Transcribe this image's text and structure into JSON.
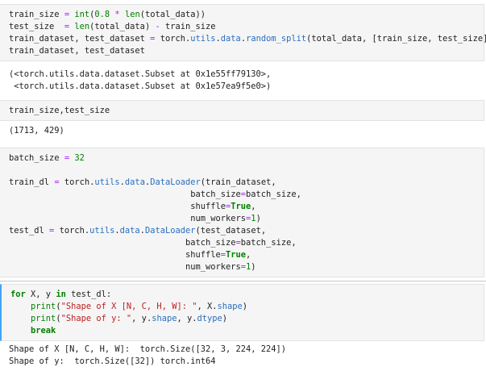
{
  "cells": [
    {
      "id": "split",
      "lines": [
        [
          [
            "train_size",
            ""
          ],
          [
            " = ",
            "op"
          ],
          [
            "int",
            "bi"
          ],
          [
            "(",
            ""
          ],
          [
            "0.8",
            "num"
          ],
          [
            " * ",
            "op"
          ],
          [
            "len",
            "bi"
          ],
          [
            "(total_data))",
            ""
          ]
        ],
        [
          [
            "test_size ",
            ""
          ],
          [
            " = ",
            "op"
          ],
          [
            "len",
            "bi"
          ],
          [
            "(total_data) ",
            ""
          ],
          [
            "-",
            "op"
          ],
          [
            " train_size",
            ""
          ]
        ],
        [
          [
            "train_dataset, test_dataset ",
            ""
          ],
          [
            "=",
            "op"
          ],
          [
            " torch.",
            ""
          ],
          [
            "utils",
            "attr"
          ],
          [
            ".",
            ""
          ],
          [
            "data",
            "attr"
          ],
          [
            ".",
            ""
          ],
          [
            "random_split",
            "attr"
          ],
          [
            "(total_data, [train_size, test_size])",
            ""
          ]
        ],
        [
          [
            "train_dataset, test_dataset",
            ""
          ]
        ]
      ],
      "output": [
        "(<torch.utils.data.dataset.Subset at 0x1e55ff79130>,",
        " <torch.utils.data.dataset.Subset at 0x1e57ea9f5e0>)"
      ]
    },
    {
      "id": "sizes",
      "lines": [
        [
          [
            "train_size,test_size",
            ""
          ]
        ]
      ],
      "output": [
        "(1713, 429)"
      ]
    },
    {
      "id": "loaders",
      "lines": [
        [
          [
            "batch_size ",
            ""
          ],
          [
            "=",
            "op"
          ],
          [
            " ",
            ""
          ],
          [
            "32",
            "num"
          ]
        ],
        [
          [
            "",
            ""
          ]
        ],
        [
          [
            "train_dl ",
            ""
          ],
          [
            "=",
            "op"
          ],
          [
            " torch.",
            ""
          ],
          [
            "utils",
            "attr"
          ],
          [
            ".",
            ""
          ],
          [
            "data",
            "attr"
          ],
          [
            ".",
            ""
          ],
          [
            "DataLoader",
            "attr"
          ],
          [
            "(train_dataset,",
            ""
          ]
        ],
        [
          [
            "                                    batch_size",
            ""
          ],
          [
            "=",
            "op"
          ],
          [
            "batch_size,",
            ""
          ]
        ],
        [
          [
            "                                    shuffle",
            ""
          ],
          [
            "=",
            "op"
          ],
          [
            "True",
            "kw"
          ],
          [
            ",",
            ""
          ]
        ],
        [
          [
            "                                    num_workers",
            ""
          ],
          [
            "=",
            "op"
          ],
          [
            "1",
            "num"
          ],
          [
            ")",
            ""
          ]
        ],
        [
          [
            "test_dl ",
            ""
          ],
          [
            "=",
            "op"
          ],
          [
            " torch.",
            ""
          ],
          [
            "utils",
            "attr"
          ],
          [
            ".",
            ""
          ],
          [
            "data",
            "attr"
          ],
          [
            ".",
            ""
          ],
          [
            "DataLoader",
            "attr"
          ],
          [
            "(test_dataset,",
            ""
          ]
        ],
        [
          [
            "                                   batch_size",
            ""
          ],
          [
            "=",
            "op"
          ],
          [
            "batch_size,",
            ""
          ]
        ],
        [
          [
            "                                   shuffle",
            ""
          ],
          [
            "=",
            "op"
          ],
          [
            "True",
            "kw"
          ],
          [
            ",",
            ""
          ]
        ],
        [
          [
            "                                   num_workers",
            ""
          ],
          [
            "=",
            "op"
          ],
          [
            "1",
            "num"
          ],
          [
            ")",
            ""
          ]
        ]
      ],
      "output": []
    },
    {
      "id": "shapes",
      "lines": [
        [
          [
            "for",
            "kw"
          ],
          [
            " X, y ",
            ""
          ],
          [
            "in",
            "kw"
          ],
          [
            " test_dl:",
            ""
          ]
        ],
        [
          [
            "    ",
            ""
          ],
          [
            "print",
            "bi"
          ],
          [
            "(",
            ""
          ],
          [
            "\"Shape of X [N, C, H, W]: \"",
            "str"
          ],
          [
            ", X.",
            ""
          ],
          [
            "shape",
            "attr"
          ],
          [
            ")",
            ""
          ]
        ],
        [
          [
            "    ",
            ""
          ],
          [
            "print",
            "bi"
          ],
          [
            "(",
            ""
          ],
          [
            "\"Shape of y: \"",
            "str"
          ],
          [
            ", y.",
            ""
          ],
          [
            "shape",
            "attr"
          ],
          [
            ", y.",
            ""
          ],
          [
            "dtype",
            "attr"
          ],
          [
            ")",
            ""
          ]
        ],
        [
          [
            "    ",
            ""
          ],
          [
            "break",
            "kw"
          ]
        ]
      ],
      "output": [
        "Shape of X [N, C, H, W]:  torch.Size([32, 3, 224, 224])",
        "Shape of y:  torch.Size([32]) torch.int64"
      ]
    }
  ]
}
